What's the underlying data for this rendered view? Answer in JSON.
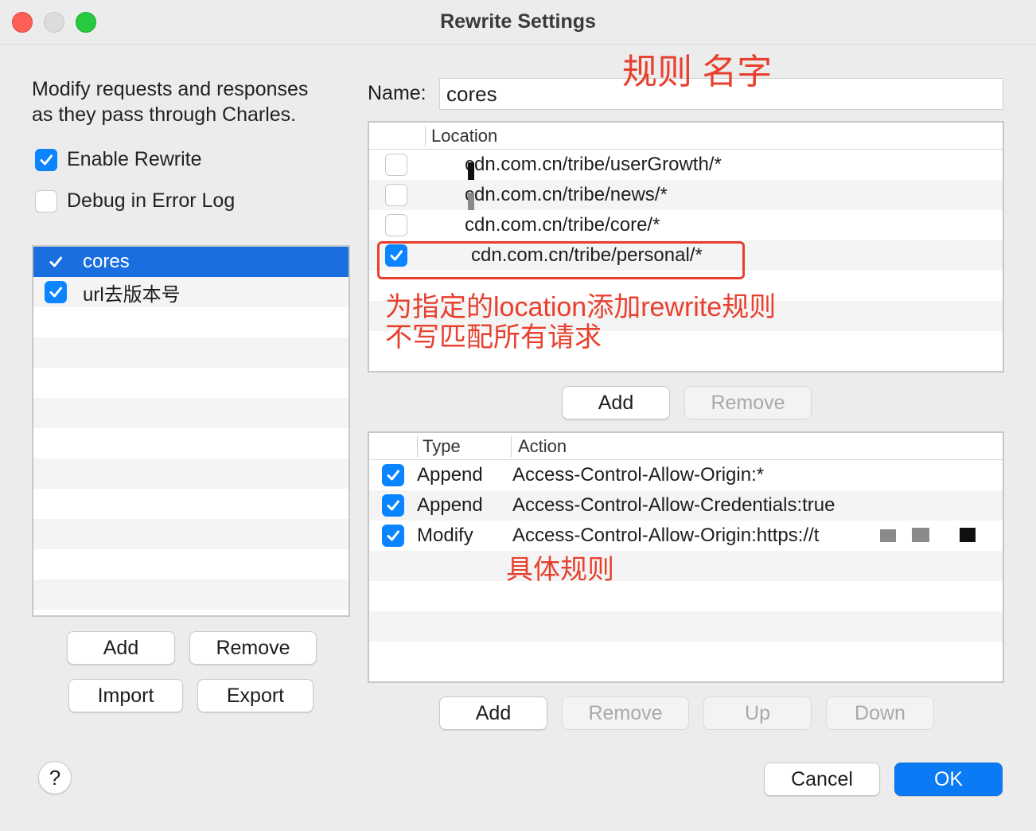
{
  "window": {
    "title": "Rewrite Settings"
  },
  "intro": {
    "line1": "Modify requests and responses",
    "line2": "as they pass through Charles."
  },
  "options": {
    "enable_rewrite": "Enable Rewrite",
    "debug_error_log": "Debug in Error Log"
  },
  "rule_sets": [
    {
      "label": "cores",
      "checked": true,
      "selected": true
    },
    {
      "label": "url去版本号",
      "checked": true,
      "selected": false
    }
  ],
  "left_buttons": {
    "add": "Add",
    "remove": "Remove",
    "import": "Import",
    "export": "Export"
  },
  "name": {
    "label": "Name:",
    "value": "cores"
  },
  "locations": {
    "header": "Location",
    "rows": [
      {
        "location": "cdn.com.cn/tribe/userGrowth/*",
        "checked": false
      },
      {
        "location": "cdn.com.cn/tribe/news/*",
        "checked": false
      },
      {
        "location": "cdn.com.cn/tribe/core/*",
        "checked": false
      },
      {
        "location": "cdn.com.cn/tribe/personal/*",
        "checked": true
      }
    ]
  },
  "location_buttons": {
    "add": "Add",
    "remove": "Remove"
  },
  "rules": {
    "header_type": "Type",
    "header_action": "Action",
    "rows": [
      {
        "type": "Append",
        "action": "Access-Control-Allow-Origin:*",
        "checked": true
      },
      {
        "type": "Append",
        "action": "Access-Control-Allow-Credentials:true",
        "checked": true
      },
      {
        "type": "Modify",
        "action": "Access-Control-Allow-Origin:https://t",
        "checked": true
      }
    ]
  },
  "rule_buttons": {
    "add": "Add",
    "remove": "Remove",
    "up": "Up",
    "down": "Down"
  },
  "footer": {
    "help": "?",
    "cancel": "Cancel",
    "ok": "OK"
  },
  "annotations": {
    "rule_name": "规则 名字",
    "location_note_1": "为指定的location添加rewrite规则",
    "location_note_2": "不写匹配所有请求",
    "rule_detail": "具体规则",
    "color": "#e8402e"
  },
  "colors": {
    "accent": "#0a84ff",
    "selection": "#1a6fe0"
  }
}
